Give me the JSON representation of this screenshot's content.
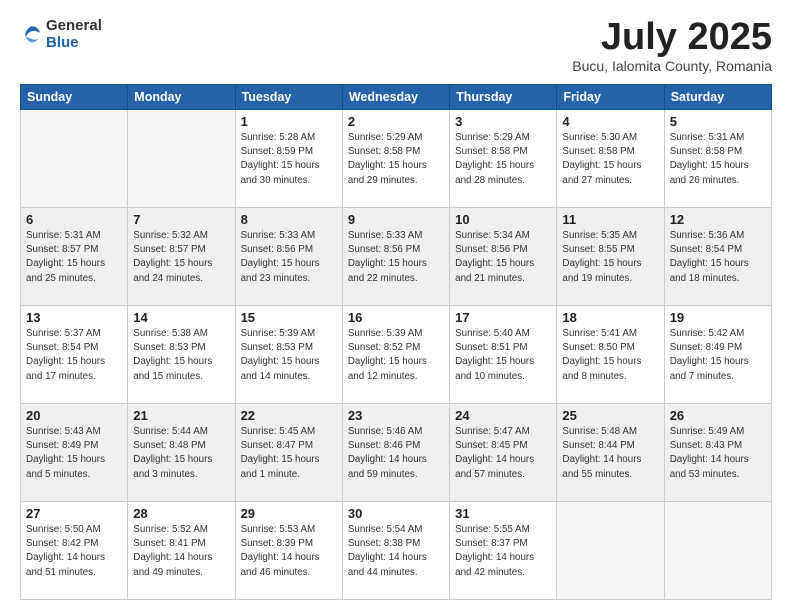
{
  "logo": {
    "general": "General",
    "blue": "Blue"
  },
  "header": {
    "month": "July 2025",
    "location": "Bucu, Ialomita County, Romania"
  },
  "weekdays": [
    "Sunday",
    "Monday",
    "Tuesday",
    "Wednesday",
    "Thursday",
    "Friday",
    "Saturday"
  ],
  "weeks": [
    [
      {
        "day": "",
        "info": ""
      },
      {
        "day": "",
        "info": ""
      },
      {
        "day": "1",
        "info": "Sunrise: 5:28 AM\nSunset: 8:59 PM\nDaylight: 15 hours\nand 30 minutes."
      },
      {
        "day": "2",
        "info": "Sunrise: 5:29 AM\nSunset: 8:58 PM\nDaylight: 15 hours\nand 29 minutes."
      },
      {
        "day": "3",
        "info": "Sunrise: 5:29 AM\nSunset: 8:58 PM\nDaylight: 15 hours\nand 28 minutes."
      },
      {
        "day": "4",
        "info": "Sunrise: 5:30 AM\nSunset: 8:58 PM\nDaylight: 15 hours\nand 27 minutes."
      },
      {
        "day": "5",
        "info": "Sunrise: 5:31 AM\nSunset: 8:58 PM\nDaylight: 15 hours\nand 26 minutes."
      }
    ],
    [
      {
        "day": "6",
        "info": "Sunrise: 5:31 AM\nSunset: 8:57 PM\nDaylight: 15 hours\nand 25 minutes."
      },
      {
        "day": "7",
        "info": "Sunrise: 5:32 AM\nSunset: 8:57 PM\nDaylight: 15 hours\nand 24 minutes."
      },
      {
        "day": "8",
        "info": "Sunrise: 5:33 AM\nSunset: 8:56 PM\nDaylight: 15 hours\nand 23 minutes."
      },
      {
        "day": "9",
        "info": "Sunrise: 5:33 AM\nSunset: 8:56 PM\nDaylight: 15 hours\nand 22 minutes."
      },
      {
        "day": "10",
        "info": "Sunrise: 5:34 AM\nSunset: 8:56 PM\nDaylight: 15 hours\nand 21 minutes."
      },
      {
        "day": "11",
        "info": "Sunrise: 5:35 AM\nSunset: 8:55 PM\nDaylight: 15 hours\nand 19 minutes."
      },
      {
        "day": "12",
        "info": "Sunrise: 5:36 AM\nSunset: 8:54 PM\nDaylight: 15 hours\nand 18 minutes."
      }
    ],
    [
      {
        "day": "13",
        "info": "Sunrise: 5:37 AM\nSunset: 8:54 PM\nDaylight: 15 hours\nand 17 minutes."
      },
      {
        "day": "14",
        "info": "Sunrise: 5:38 AM\nSunset: 8:53 PM\nDaylight: 15 hours\nand 15 minutes."
      },
      {
        "day": "15",
        "info": "Sunrise: 5:39 AM\nSunset: 8:53 PM\nDaylight: 15 hours\nand 14 minutes."
      },
      {
        "day": "16",
        "info": "Sunrise: 5:39 AM\nSunset: 8:52 PM\nDaylight: 15 hours\nand 12 minutes."
      },
      {
        "day": "17",
        "info": "Sunrise: 5:40 AM\nSunset: 8:51 PM\nDaylight: 15 hours\nand 10 minutes."
      },
      {
        "day": "18",
        "info": "Sunrise: 5:41 AM\nSunset: 8:50 PM\nDaylight: 15 hours\nand 8 minutes."
      },
      {
        "day": "19",
        "info": "Sunrise: 5:42 AM\nSunset: 8:49 PM\nDaylight: 15 hours\nand 7 minutes."
      }
    ],
    [
      {
        "day": "20",
        "info": "Sunrise: 5:43 AM\nSunset: 8:49 PM\nDaylight: 15 hours\nand 5 minutes."
      },
      {
        "day": "21",
        "info": "Sunrise: 5:44 AM\nSunset: 8:48 PM\nDaylight: 15 hours\nand 3 minutes."
      },
      {
        "day": "22",
        "info": "Sunrise: 5:45 AM\nSunset: 8:47 PM\nDaylight: 15 hours\nand 1 minute."
      },
      {
        "day": "23",
        "info": "Sunrise: 5:46 AM\nSunset: 8:46 PM\nDaylight: 14 hours\nand 59 minutes."
      },
      {
        "day": "24",
        "info": "Sunrise: 5:47 AM\nSunset: 8:45 PM\nDaylight: 14 hours\nand 57 minutes."
      },
      {
        "day": "25",
        "info": "Sunrise: 5:48 AM\nSunset: 8:44 PM\nDaylight: 14 hours\nand 55 minutes."
      },
      {
        "day": "26",
        "info": "Sunrise: 5:49 AM\nSunset: 8:43 PM\nDaylight: 14 hours\nand 53 minutes."
      }
    ],
    [
      {
        "day": "27",
        "info": "Sunrise: 5:50 AM\nSunset: 8:42 PM\nDaylight: 14 hours\nand 51 minutes."
      },
      {
        "day": "28",
        "info": "Sunrise: 5:52 AM\nSunset: 8:41 PM\nDaylight: 14 hours\nand 49 minutes."
      },
      {
        "day": "29",
        "info": "Sunrise: 5:53 AM\nSunset: 8:39 PM\nDaylight: 14 hours\nand 46 minutes."
      },
      {
        "day": "30",
        "info": "Sunrise: 5:54 AM\nSunset: 8:38 PM\nDaylight: 14 hours\nand 44 minutes."
      },
      {
        "day": "31",
        "info": "Sunrise: 5:55 AM\nSunset: 8:37 PM\nDaylight: 14 hours\nand 42 minutes."
      },
      {
        "day": "",
        "info": ""
      },
      {
        "day": "",
        "info": ""
      }
    ]
  ]
}
